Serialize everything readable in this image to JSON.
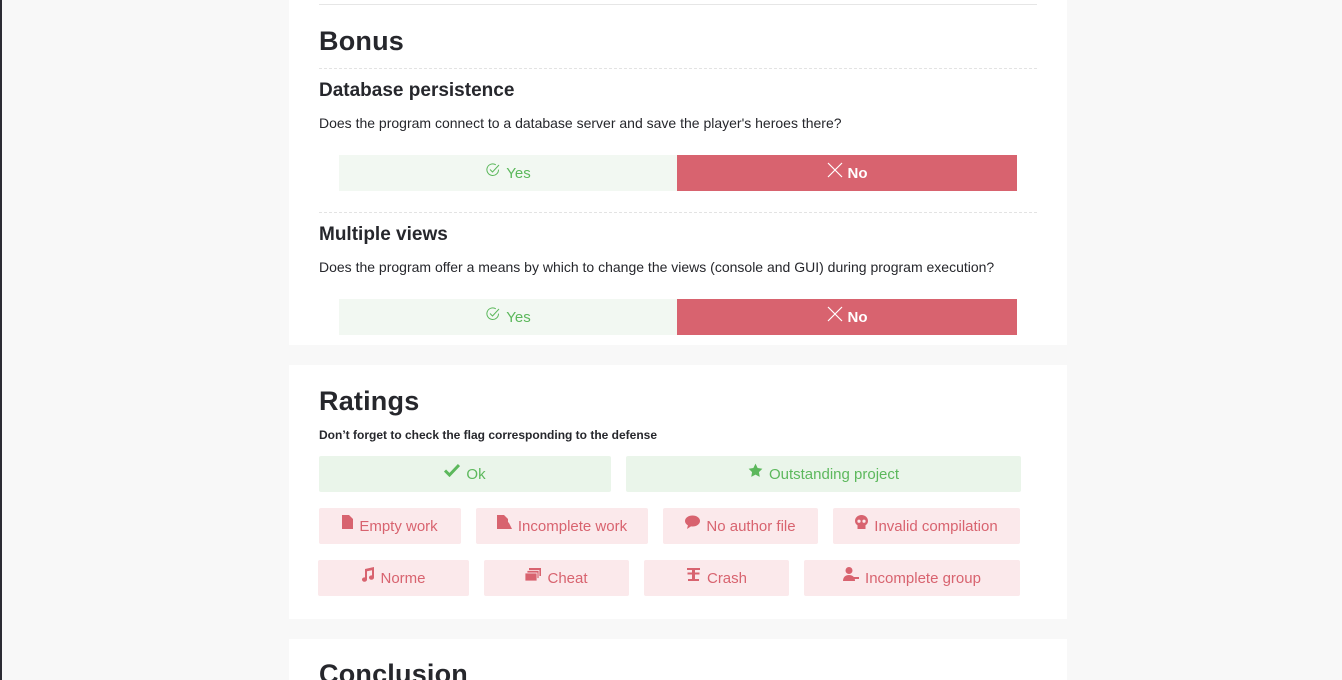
{
  "bonus": {
    "title": "Bonus",
    "questions": [
      {
        "title": "Database persistence",
        "description": "Does the program connect to a database server and save the player's heroes there?",
        "yes_label": "Yes",
        "no_label": "No",
        "selected": "No"
      },
      {
        "title": "Multiple views",
        "description": "Does the program offer a means by which to change the views (console and GUI) during program execution?",
        "yes_label": "Yes",
        "no_label": "No",
        "selected": "No"
      }
    ]
  },
  "ratings": {
    "title": "Ratings",
    "note": "Don’t forget to check the flag corresponding to the defense",
    "positive_flags": [
      {
        "label": "Ok",
        "icon": "check-icon"
      },
      {
        "label": "Outstanding project",
        "icon": "star-icon"
      }
    ],
    "negative_flags": [
      {
        "label": "Empty work",
        "icon": "file-icon"
      },
      {
        "label": "Incomplete work",
        "icon": "incomplete-file-icon"
      },
      {
        "label": "No author file",
        "icon": "speech-bubble-icon"
      },
      {
        "label": "Invalid compilation",
        "icon": "skull-icon"
      },
      {
        "label": "Norme",
        "icon": "music-note-icon"
      },
      {
        "label": "Cheat",
        "icon": "cards-icon"
      },
      {
        "label": "Crash",
        "icon": "explosion-icon"
      },
      {
        "label": "Incomplete group",
        "icon": "user-icon"
      }
    ]
  },
  "conclusion": {
    "title": "Conclusion"
  },
  "colors": {
    "positive": "#5cb85c",
    "negative": "#d8636f",
    "page_bg": "#f8f8f8"
  }
}
